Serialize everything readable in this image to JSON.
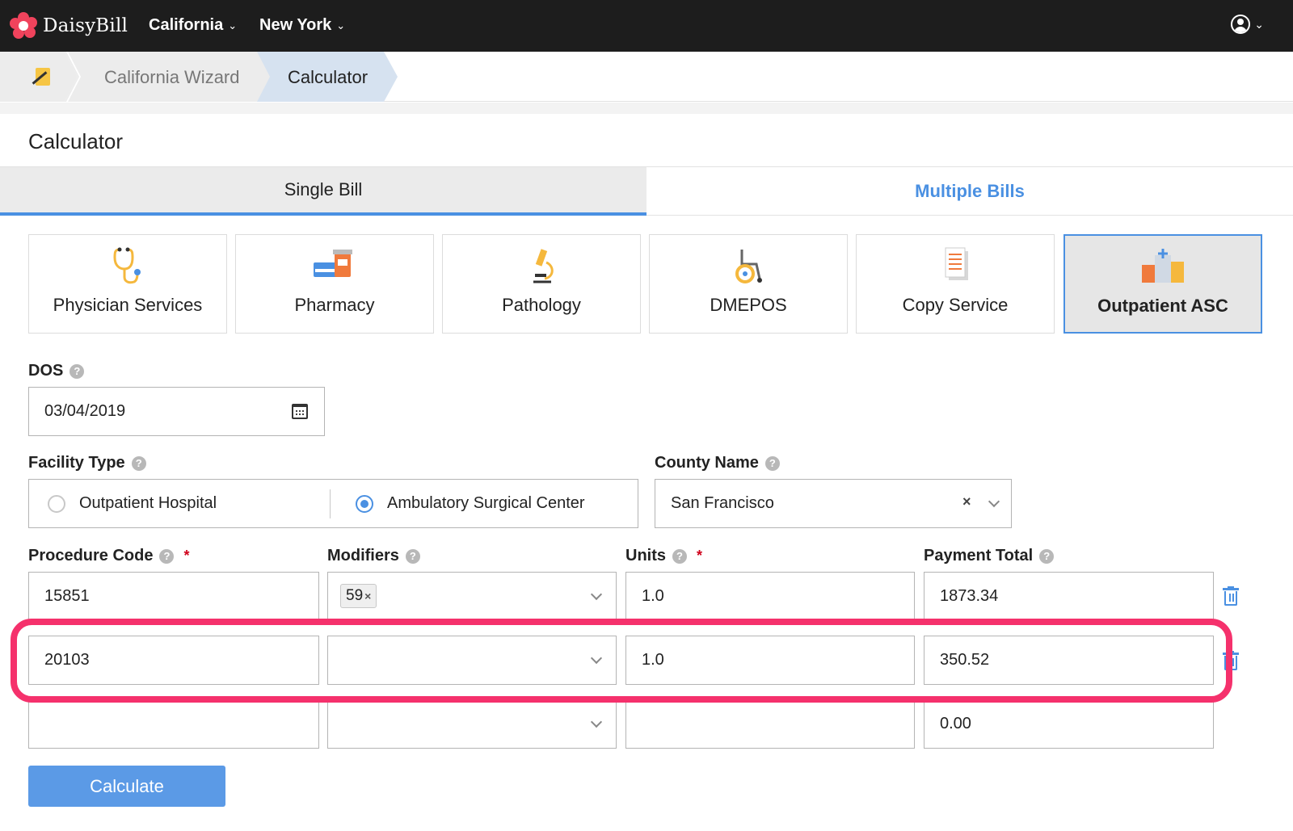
{
  "topnav": {
    "logo_text": "DaisyBill",
    "logo_color": "#f0435c",
    "states": [
      {
        "label": "California",
        "icon": "chevron-down-icon"
      },
      {
        "label": "New York",
        "icon": "chevron-down-icon"
      }
    ],
    "user_icon": "user-circle-icon"
  },
  "breadcrumb": {
    "home_icon": "note-pen-icon",
    "items": [
      "California Wizard",
      "Calculator"
    ]
  },
  "page": {
    "title": "Calculator"
  },
  "tabs": [
    {
      "label": "Single Bill",
      "active": true
    },
    {
      "label": "Multiple Bills",
      "active": false
    }
  ],
  "services": [
    {
      "label": "Physician Services",
      "icon": "stethoscope-icon",
      "active": false
    },
    {
      "label": "Pharmacy",
      "icon": "pharmacy-pills-icon",
      "active": false
    },
    {
      "label": "Pathology",
      "icon": "microscope-icon",
      "active": false
    },
    {
      "label": "DMEPOS",
      "icon": "wheelchair-icon",
      "active": false
    },
    {
      "label": "Copy Service",
      "icon": "document-copy-icon",
      "active": false
    },
    {
      "label": "Outpatient ASC",
      "icon": "hospital-building-icon",
      "active": true
    }
  ],
  "form": {
    "dos": {
      "label": "DOS",
      "value": "03/04/2019"
    },
    "facility": {
      "label": "Facility Type",
      "options": [
        {
          "label": "Outpatient Hospital",
          "selected": false
        },
        {
          "label": "Ambulatory Surgical Center",
          "selected": true
        }
      ]
    },
    "county": {
      "label": "County Name",
      "value": "San Francisco"
    },
    "columns": {
      "procedure": "Procedure Code",
      "modifiers": "Modifiers",
      "units": "Units",
      "payment": "Payment Total",
      "required_mark": "*"
    },
    "rows": [
      {
        "procedure": "15851",
        "modifiers": [
          "59"
        ],
        "units": "1.0",
        "payment": "1873.34"
      },
      {
        "procedure": "20103",
        "modifiers": [],
        "units": "1.0",
        "payment": "350.52"
      },
      {
        "procedure": "",
        "modifiers": [],
        "units": "",
        "payment": "0.00"
      }
    ],
    "highlight_color": "#f5316c",
    "calculate_label": "Calculate"
  }
}
